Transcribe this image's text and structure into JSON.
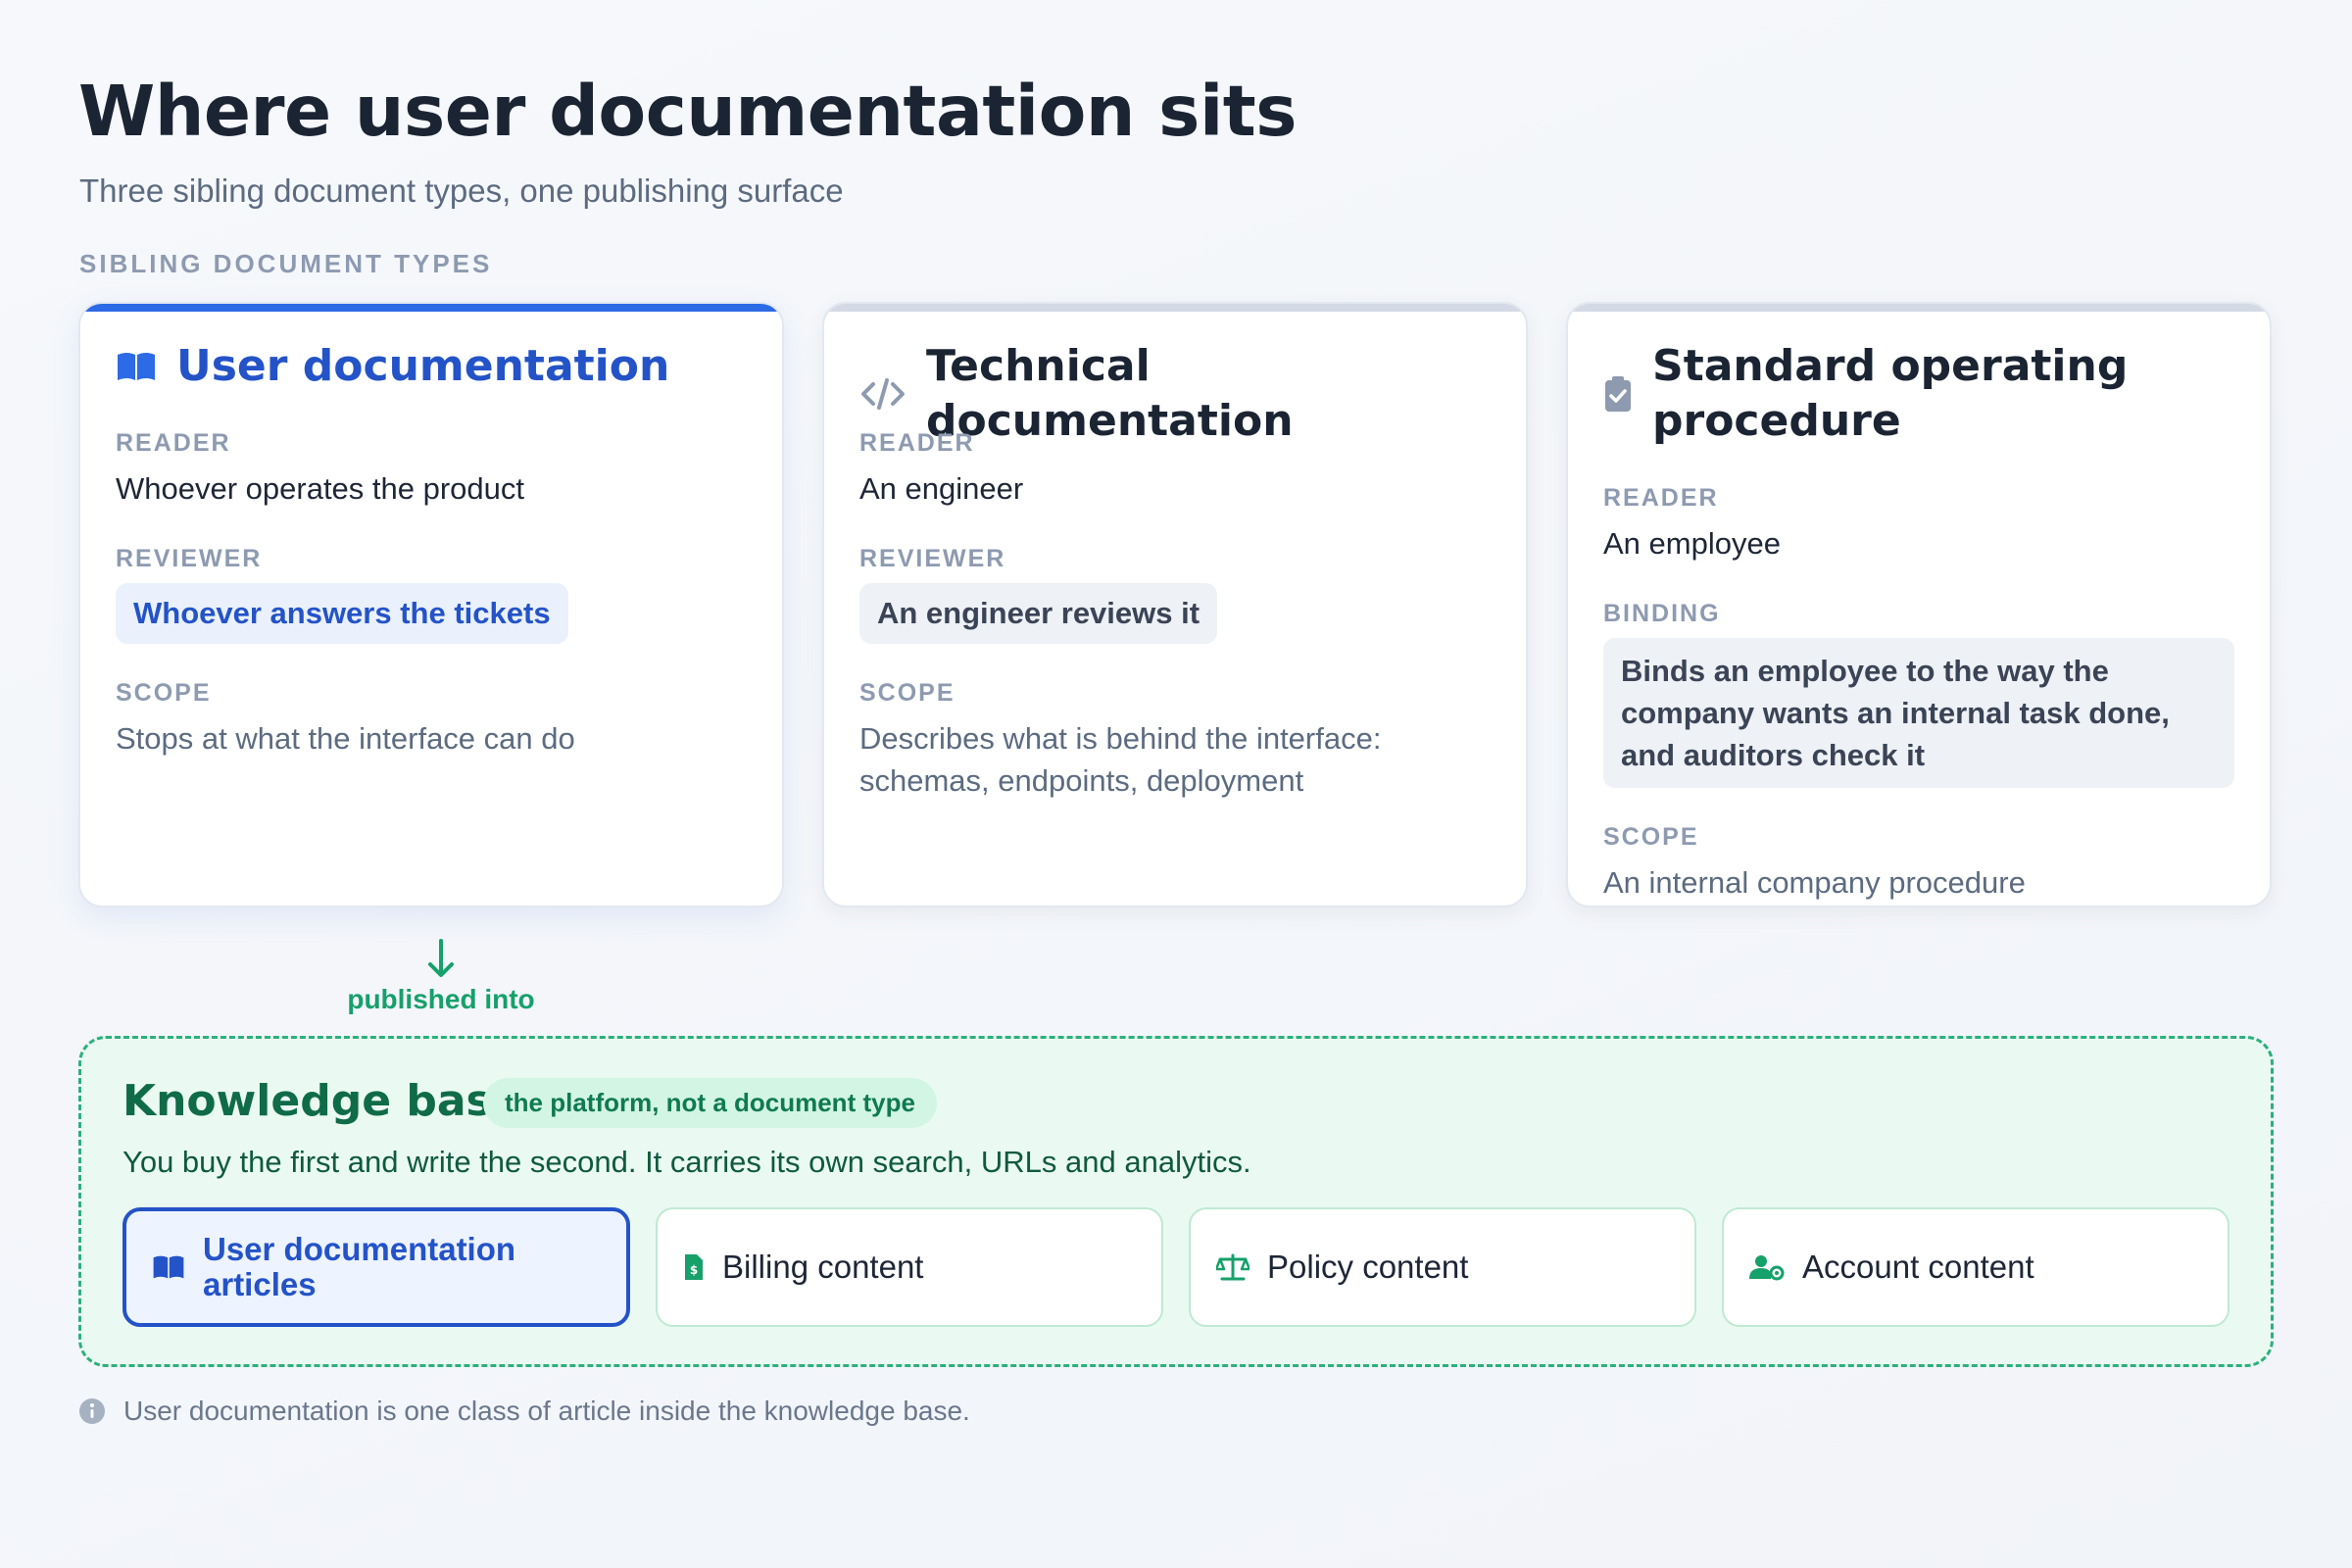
{
  "title": "Where user documentation sits",
  "subtitle": "Three sibling document types, one publishing surface",
  "section_label": "SIBLING DOCUMENT TYPES",
  "cards": [
    {
      "title": "User documentation",
      "icon": "book-icon",
      "accent": "#2d6ae6",
      "fields": {
        "reader_label": "READER",
        "reader": "Whoever operates the product",
        "reviewer_label": "REVIEWER",
        "reviewer": "Whoever answers the tickets",
        "scope_label": "SCOPE",
        "scope": "Stops at what the interface can do"
      }
    },
    {
      "title": "Technical documentation",
      "icon": "code-icon",
      "fields": {
        "reader_label": "READER",
        "reader": "An engineer",
        "reviewer_label": "REVIEWER",
        "reviewer": "An engineer reviews it",
        "scope_label": "SCOPE",
        "scope": "Describes what is behind the interface: schemas, endpoints, deployment"
      }
    },
    {
      "title": "Standard operating procedure",
      "icon": "clipboard-check-icon",
      "fields": {
        "reader_label": "READER",
        "reader": "An employee",
        "binding_label": "BINDING",
        "binding": "Binds an employee to the way the company wants an internal task done, and auditors check it",
        "scope_label": "SCOPE",
        "scope": "An internal company procedure"
      }
    }
  ],
  "connector": {
    "label": "published into",
    "icon": "arrow-down-icon",
    "color": "#16a06a"
  },
  "knowledge_base": {
    "title": "Knowledge base",
    "badge": "the platform, not a document type",
    "description": "You buy the first and write the second. It carries its own search, URLs and analytics.",
    "items": [
      {
        "label": "User documentation articles",
        "icon": "book-icon",
        "active": true
      },
      {
        "label": "Billing content",
        "icon": "invoice-icon"
      },
      {
        "label": "Policy content",
        "icon": "scale-icon"
      },
      {
        "label": "Account content",
        "icon": "user-gear-icon"
      }
    ]
  },
  "footnote": "User documentation is one class of article inside the knowledge base."
}
